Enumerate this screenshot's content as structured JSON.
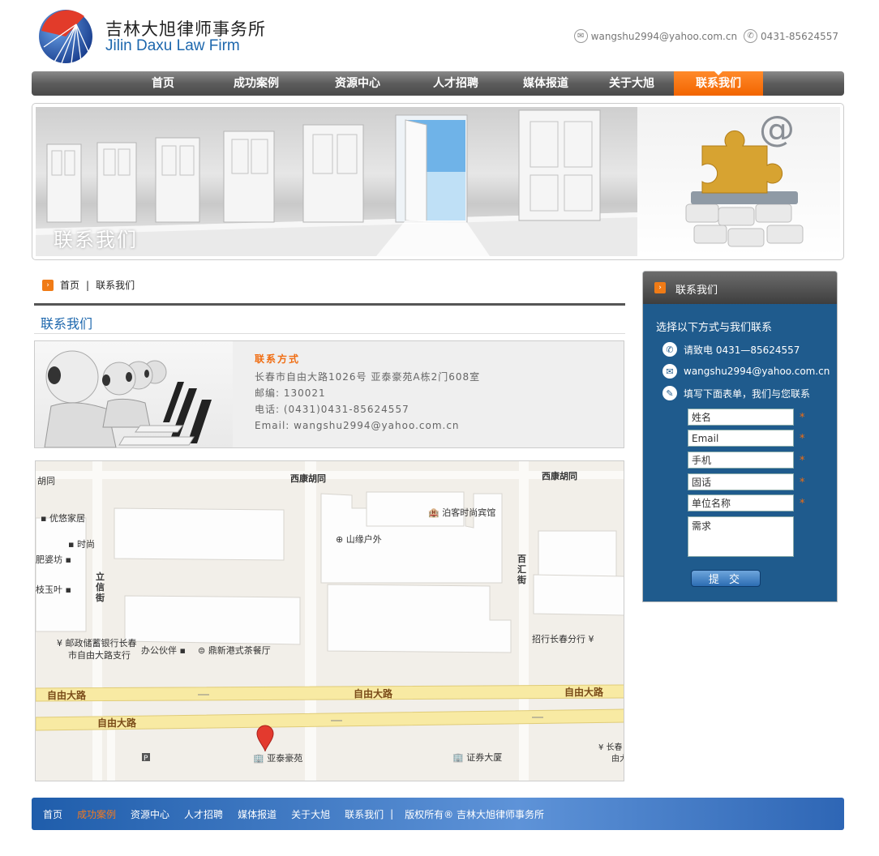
{
  "header": {
    "firm_name_cn": "吉林大旭律师事务所",
    "firm_name_en": "Jilin Daxu Law Firm",
    "email": "wangshu2994@yahoo.com.cn",
    "phone": "0431-85624557"
  },
  "nav": {
    "items": [
      "首页",
      "成功案例",
      "资源中心",
      "人才招聘",
      "媒体报道",
      "关于大旭",
      "联系我们"
    ],
    "active_index": 6
  },
  "banner": {
    "title": "联系我们"
  },
  "breadcrumb": {
    "home": "首页",
    "sep": "|",
    "current": "联系我们"
  },
  "section": {
    "title": "联系我们"
  },
  "contact": {
    "heading": "联系方式",
    "address": "长春市自由大路1026号 亚泰豪苑A栋2门608室",
    "postcode": "邮编:  130021",
    "tel": "电话:  (0431)0431-85624557",
    "email": "Email: wangshu2994@yahoo.com.cn"
  },
  "map": {
    "labels": [
      "西康胡同",
      "西康胡同",
      "胡同",
      "优悠家居",
      "时尚",
      "肥婆坊",
      "枝玉叶",
      "泊客时尚宾馆",
      "山缘户外",
      "立信街",
      "百汇街",
      "邮政储蓄银行长春",
      "市自由大路支行",
      "办公伙伴",
      "鼎新港式茶餐厅",
      "招行长春分行",
      "自由大路",
      "自由大路",
      "自由大路",
      "自由大路",
      "亚泰豪苑",
      "证券大厦",
      "长春",
      "由大"
    ]
  },
  "sidebar": {
    "title": "联系我们",
    "intro": "选择以下方式与我们联系",
    "phone_label": "请致电  0431—85624557",
    "email_label": "wangshu2994@yahoo.com.cn",
    "form_label": "填写下面表单，我们与您联系",
    "fields": {
      "name": "姓名",
      "email": "Email",
      "mobile": "手机",
      "landline": "固话",
      "company": "单位名称",
      "need": "需求"
    },
    "required_mark": "*",
    "submit": "提 交"
  },
  "footer": {
    "links": [
      "首页",
      "成功案例",
      "资源中心",
      "人才招聘",
      "媒体报道",
      "关于大旭",
      "联系我们"
    ],
    "highlight_index": 1,
    "sep": "|",
    "copyright": "版权所有® 吉林大旭律师事务所"
  },
  "colors": {
    "nav_active": "#f26400",
    "brand_blue": "#1d67ad",
    "sidebar_bg": "#1f5b8d"
  }
}
